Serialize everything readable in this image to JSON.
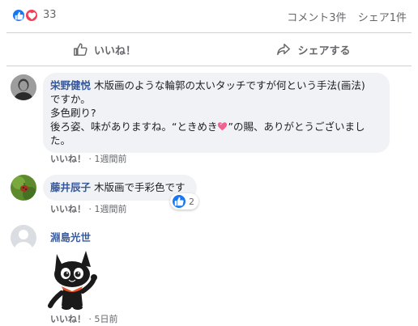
{
  "reactions": {
    "count": "33",
    "icons": [
      "like-icon",
      "love-icon"
    ],
    "like_color": "#1877f2",
    "love_color": "#f33e58"
  },
  "stats": {
    "comments": "コメント3件",
    "shares": "シェア1件"
  },
  "actions": {
    "like_label": "いいね！",
    "share_label": "シェアする"
  },
  "comments": [
    {
      "author": "栄野健悦",
      "lines": [
        "木版画のような輪郭の太いタッチですが何という手法(画法)",
        "ですか。",
        "多色刷り?",
        "後ろ姿、味がありますね。“ときめき",
        "”の賜、ありがとうございまし",
        "た。"
      ],
      "like_label": "いいね！",
      "time": "1週間前"
    },
    {
      "author": "藤井辰子",
      "text": "木版画で手彩色です",
      "like_label": "いいね！",
      "time": "1週間前",
      "reaction_count": "2"
    },
    {
      "author": "淵島光世",
      "sticker": "black-cat-sticker",
      "like_label": "いいね！",
      "time": "5日前"
    }
  ],
  "separator": "·",
  "accent_color": "#385898"
}
